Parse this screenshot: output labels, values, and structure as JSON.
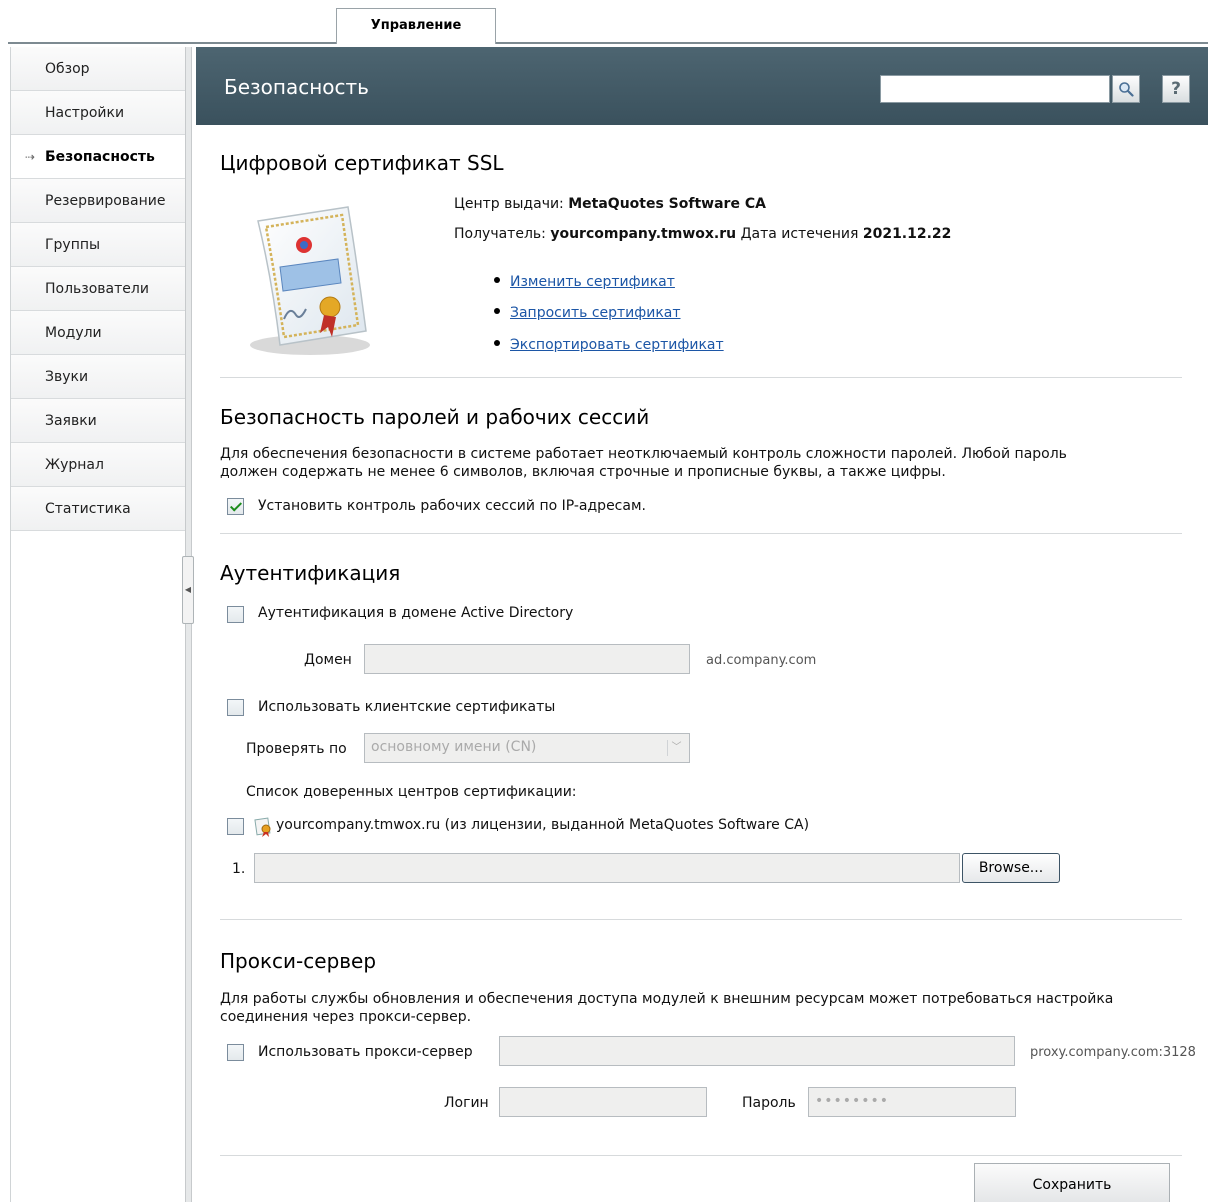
{
  "tabs": [
    {
      "label": "Управление",
      "active": true
    }
  ],
  "sidebar": {
    "items": [
      {
        "label": "Обзор"
      },
      {
        "label": "Настройки"
      },
      {
        "label": "Безопасность",
        "active": true
      },
      {
        "label": "Резервирование"
      },
      {
        "label": "Группы"
      },
      {
        "label": "Пользователи"
      },
      {
        "label": "Модули"
      },
      {
        "label": "Звуки"
      },
      {
        "label": "Заявки"
      },
      {
        "label": "Журнал"
      },
      {
        "label": "Статистика"
      }
    ],
    "active_marker": "⇢"
  },
  "header": {
    "title": "Безопасность",
    "search_value": "",
    "help_label": "?"
  },
  "ssl": {
    "title": "Цифровой сертификат SSL",
    "issuer_label": "Центр выдачи:",
    "issuer_value": "MetaQuotes Software CA",
    "recipient_label": "Получатель:",
    "recipient_value": "yourcompany.tmwox.ru",
    "expiry_label": "Дата истечения",
    "expiry_value": "2021.12.22",
    "links": [
      "Изменить сертификат",
      "Запросить сертификат",
      "Экспортировать сертификат"
    ]
  },
  "passwords": {
    "title": "Безопасность паролей и рабочих сессий",
    "desc_line1": "Для обеспечения безопасности в системе работает неотключаемый контроль сложности паролей. Любой пароль",
    "desc_line2": "должен содержать не менее 6 символов, включая строчные и прописные буквы, а также цифры.",
    "ip_control_label": "Установить контроль рабочих сессий по IP-адресам.",
    "ip_control_checked": true
  },
  "auth": {
    "title": "Аутентификация",
    "ad_label": "Аутентификация в домене Active Directory",
    "ad_checked": false,
    "domain_label": "Домен",
    "domain_value": "",
    "domain_hint": "ad.company.com",
    "client_certs_label": "Использовать клиентские сертификаты",
    "client_certs_checked": false,
    "check_by_label": "Проверять по",
    "check_by_value": "основному имени (CN)",
    "trusted_list_label": "Список доверенных центров сертификации:",
    "trusted_ca_label": "yourcompany.tmwox.ru (из лицензии, выданной MetaQuotes Software CA)",
    "trusted_ca_checked": false,
    "file_row_number": "1.",
    "file_value": "",
    "browse_label": "Browse..."
  },
  "proxy": {
    "title": "Прокси-сервер",
    "desc_line1": "Для работы службы обновления и обеспечения доступа модулей к внешним ресурсам может потребоваться настройка",
    "desc_line2": "соединения через прокси-сервер.",
    "use_label": "Использовать прокси-сервер",
    "use_checked": false,
    "proxy_value": "",
    "proxy_hint": "proxy.company.com:3128",
    "login_label": "Логин",
    "login_value": "",
    "password_label": "Пароль",
    "password_value": "••••••••"
  },
  "save_label": "Сохранить"
}
